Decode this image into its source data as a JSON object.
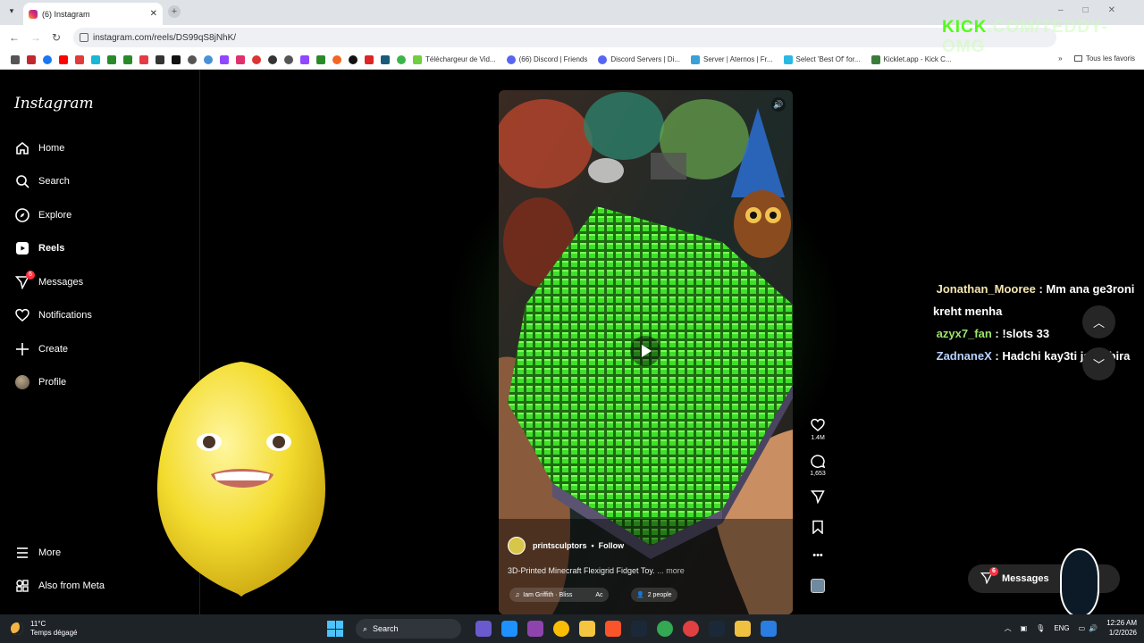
{
  "browser": {
    "tab_title": "(6) Instagram",
    "tab_close": "✕",
    "url": "instagram.com/reels/DS99qS8jNhK/",
    "bookmarks": [
      {
        "label": "Téléchargeur de Vid...",
        "color": "#6fcf3f"
      },
      {
        "label": "(66) Discord | Friends",
        "color": "#5865f2"
      },
      {
        "label": "Discord Servers | Di...",
        "color": "#5865f2"
      },
      {
        "label": "Server | Aternos | Fr...",
        "color": "#3aa0d8"
      },
      {
        "label": "Select 'Best Of' for...",
        "color": "#28b9e5"
      },
      {
        "label": "Kicklet.app - Kick C...",
        "color": "#3a7d3a"
      }
    ],
    "all_bookmarks": "Tous les favoris"
  },
  "sidebar": {
    "logo": "Instagram",
    "items": [
      {
        "label": "Home",
        "icon": "home-icon"
      },
      {
        "label": "Search",
        "icon": "search-icon"
      },
      {
        "label": "Explore",
        "icon": "explore-icon"
      },
      {
        "label": "Reels",
        "icon": "reels-icon"
      },
      {
        "label": "Messages",
        "icon": "messages-icon",
        "badge": "6"
      },
      {
        "label": "Notifications",
        "icon": "heart-icon"
      },
      {
        "label": "Create",
        "icon": "plus-icon"
      },
      {
        "label": "Profile",
        "icon": "avatar-icon"
      }
    ],
    "more": "More",
    "also_from_meta": "Also from Meta"
  },
  "reel": {
    "author": "printsculptors",
    "follow": "Follow",
    "caption": "3D-Printed Minecraft Flexigrid Fidget Toy.",
    "more": "... more",
    "audio": "Iam Griffith · Bliss",
    "audio_suffix": "Ac",
    "people": "2 people",
    "likes": "1.4M",
    "comments": "1,653"
  },
  "chat": [
    {
      "user": "Jonathan_Mooree",
      "message": "Mm ana ge3roni kreht menha"
    },
    {
      "user": "azyx7_fan",
      "message": "!slots 33"
    },
    {
      "user": "ZadnaneX",
      "message": "Hadchi kay3ti jaw kbira"
    }
  ],
  "overlay": {
    "kick_brand": "KICK",
    "kick_rest": ".COM/TEDDY-OMG"
  },
  "messages_pill": {
    "label": "Messages",
    "badge": "6"
  },
  "taskbar": {
    "temp": "11°C",
    "weather": "Temps dégagé",
    "search": "Search",
    "lang": "ENG",
    "time": "12:26 AM",
    "date": "1/2/2026"
  }
}
